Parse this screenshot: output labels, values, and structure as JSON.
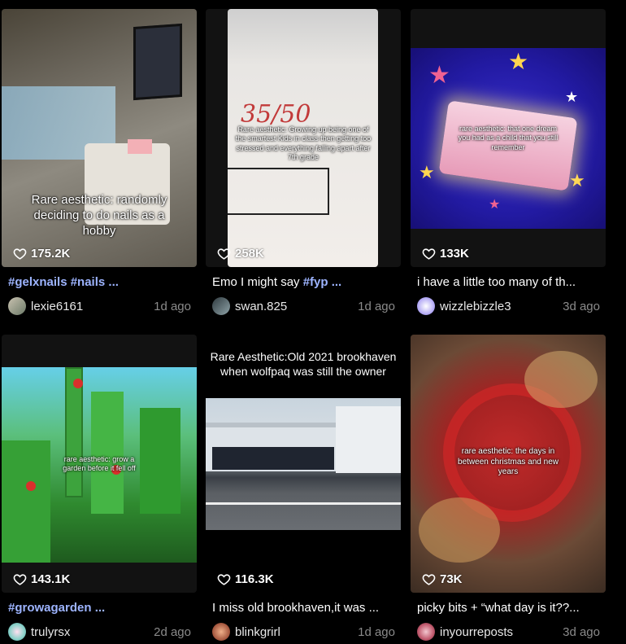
{
  "colors": {
    "tag": "#9db4ff",
    "muted": "#8a8a8a",
    "bg": "#000000"
  },
  "cards": [
    {
      "overlay": "Rare aesthetic: randomly deciding to do nails as a hobby",
      "likes": "175.2K",
      "caption_tag": "#gelxnails #nails ...",
      "caption": "",
      "username": "lexie6161",
      "ago": "1d ago"
    },
    {
      "overlay": "Rare aesthetic: Growing up being one of the smartest Kids in class then getting too stressed and everything falling apart after 7th grade",
      "score": "35/50",
      "likes": "258K",
      "caption_tag": "#fyp ...",
      "caption": "Emo I might say ",
      "username": "swan.825",
      "ago": "1d ago"
    },
    {
      "overlay": "rare aesthetic: that one dream you had as a child that you still remember",
      "likes": "133K",
      "caption_tag": "",
      "caption": "i have a little too many of th...",
      "username": "wizzlebizzle3",
      "ago": "3d ago"
    },
    {
      "overlay": "rare aesthetic: grow a garden before it fell off",
      "likes": "143.1K",
      "caption_tag": "#growagarden ...",
      "caption": "",
      "username": "trulyrsx",
      "ago": "2d ago"
    },
    {
      "overlay": "Rare Aesthetic:Old 2021 brookhaven when wolfpaq was still the owner",
      "likes": "116.3K",
      "caption_tag": "",
      "caption": "I miss old brookhaven,it was ...",
      "username": "blinkgrirl",
      "ago": "1d ago"
    },
    {
      "overlay": "rare aesthetic: the days in between christmas and new years",
      "likes": "73K",
      "caption_tag": "",
      "caption": "picky bits + “what day is it??...",
      "username": "inyourreposts",
      "ago": "3d ago"
    }
  ]
}
